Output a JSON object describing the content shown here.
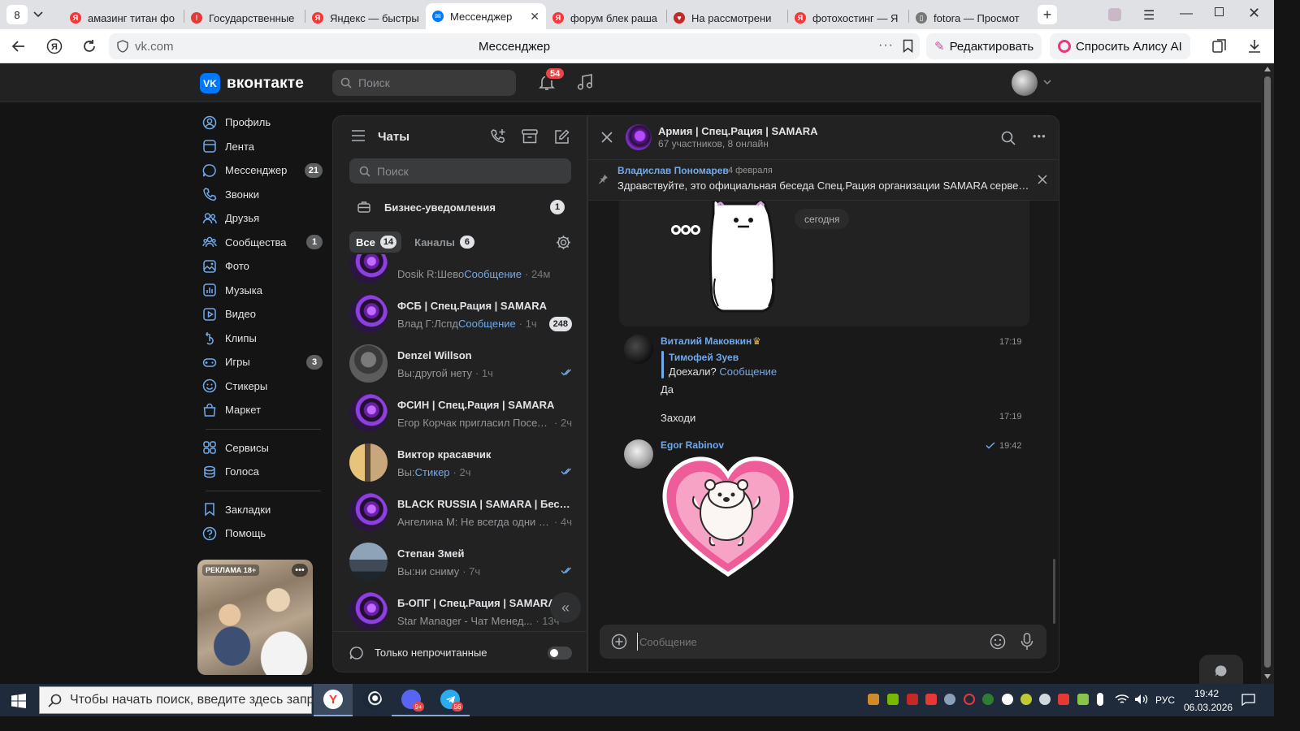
{
  "browser": {
    "tab_count": "8",
    "tabs": [
      {
        "title": "амазинг титан фо",
        "fav_color": "#f33",
        "fav_glyph": "Я",
        "active": false
      },
      {
        "title": "Государственные",
        "fav_color": "#e53935",
        "fav_glyph": "!",
        "active": false
      },
      {
        "title": "Яндекс — быстры",
        "fav_color": "#f33",
        "fav_glyph": "Я",
        "active": false
      },
      {
        "title": "Мессенджер",
        "fav_color": "#0077ff",
        "fav_glyph": "✉",
        "active": true
      },
      {
        "title": "форум блек раша",
        "fav_color": "#f33",
        "fav_glyph": "Я",
        "active": false
      },
      {
        "title": "На рассмотрени",
        "fav_color": "#c62828",
        "fav_glyph": "♥",
        "active": false
      },
      {
        "title": "фотохостинг — Я",
        "fav_color": "#f33",
        "fav_glyph": "Я",
        "active": false
      },
      {
        "title": "fotora — Просмот",
        "fav_color": "#777",
        "fav_glyph": "▯",
        "active": false
      }
    ],
    "url": "vk.com",
    "page_title": "Мессенджер",
    "edit_label": "Редактировать",
    "alice_label": "Спросить Алису AI"
  },
  "vk": {
    "logo_text": "вконтакте",
    "logo_mark": "VK",
    "search_placeholder": "Поиск",
    "notifications_count": "54",
    "nav": [
      {
        "label": "Профиль",
        "icon": "profile-icon",
        "count": ""
      },
      {
        "label": "Лента",
        "icon": "feed-icon",
        "count": ""
      },
      {
        "label": "Мессенджер",
        "icon": "messenger-icon",
        "count": "21"
      },
      {
        "label": "Звонки",
        "icon": "phone-icon",
        "count": ""
      },
      {
        "label": "Друзья",
        "icon": "friends-icon",
        "count": ""
      },
      {
        "label": "Сообщества",
        "icon": "communities-icon",
        "count": "1"
      },
      {
        "label": "Фото",
        "icon": "photo-icon",
        "count": ""
      },
      {
        "label": "Музыка",
        "icon": "music-icon",
        "count": ""
      },
      {
        "label": "Видео",
        "icon": "video-icon",
        "count": ""
      },
      {
        "label": "Клипы",
        "icon": "clips-icon",
        "count": ""
      },
      {
        "label": "Игры",
        "icon": "games-icon",
        "count": "3"
      },
      {
        "label": "Стикеры",
        "icon": "stickers-icon",
        "count": ""
      },
      {
        "label": "Маркет",
        "icon": "market-icon",
        "count": ""
      }
    ],
    "nav2": [
      {
        "label": "Сервисы",
        "icon": "services-icon"
      },
      {
        "label": "Голоса",
        "icon": "votes-icon"
      }
    ],
    "nav3": [
      {
        "label": "Закладки",
        "icon": "bookmark-icon"
      },
      {
        "label": "Помощь",
        "icon": "help-icon"
      }
    ],
    "ad_label": "РЕКЛАМА 18+"
  },
  "chats": {
    "title": "Чаты",
    "search_placeholder": "Поиск",
    "business_label": "Бизнес-уведомления",
    "business_count": "1",
    "tab_all": "Все",
    "tab_all_count": "14",
    "tab_channels": "Каналы",
    "tab_channels_count": "6",
    "list": [
      {
        "name": "",
        "sender": "Dosik R: ",
        "text": "Шево ",
        "link": "Сообщение",
        "time": " · 24м",
        "unread": "",
        "read": false,
        "av": "purple"
      },
      {
        "name": "ФСБ | Спец.Рация | SAMARA",
        "sender": "Влад Г: ",
        "text": "Лспд ",
        "link": "Сообщение",
        "time": " · 1ч",
        "unread": "248",
        "read": false,
        "av": "purple"
      },
      {
        "name": "Denzel Willson",
        "sender": "Вы: ",
        "text": "другой нету",
        "link": "",
        "time": " · 1ч",
        "unread": "",
        "read": true,
        "av": "grey"
      },
      {
        "name": "ФСИН | Спец.Рация | SAMARA",
        "sender": "",
        "text": "Егор Корчак пригласил Посел...",
        "link": "",
        "time": " · 2ч",
        "unread": "",
        "read": false,
        "av": "purple"
      },
      {
        "name": "Виктор красавчик",
        "sender": "Вы: ",
        "text": "",
        "link": "Стикер",
        "time": " · 2ч",
        "unread": "",
        "read": true,
        "av": "photo"
      },
      {
        "name": "BLACK RUSSIA | SAMARA | Беседа...",
        "sender": "",
        "text": "Ангелина М: Не всегда одни и ...",
        "link": "",
        "time": " · 4ч",
        "unread": "",
        "read": false,
        "av": "purple"
      },
      {
        "name": "Степан Змей",
        "sender": "Вы: ",
        "text": "ни сниму",
        "link": "",
        "time": " · 7ч",
        "unread": "",
        "read": true,
        "av": "street"
      },
      {
        "name": "Б-ОПГ | Спец.Рация | SAMARA",
        "sender": "",
        "text": "Star Manager - Чат Менед...",
        "link": "",
        "time": " · 13ч",
        "unread": "",
        "read": false,
        "av": "purple"
      }
    ],
    "unread_only_label": "Только непрочитанные"
  },
  "conversation": {
    "title": "Армия | Спец.Рация | SAMARA",
    "subtitle": "67 участников, 8 онлайн",
    "pinned_author": "Владислав Пономарев",
    "pinned_date": "4 февраля",
    "pinned_text": "Здравствуйте, это официальная беседа Спец.Рация организации SAMARA сервера...",
    "date_chip": "сегодня",
    "messages": [
      {
        "author": "Виталий Маковкин",
        "time": "17:19",
        "reply_author": "Тимофей Зуев",
        "reply_text": "Доехали? ",
        "reply_link": "Сообщение",
        "text": "Да"
      },
      {
        "author": "",
        "time": "17:19",
        "text": "Заходи"
      },
      {
        "author": "Egor Rabinov",
        "time": "19:42",
        "text": ""
      }
    ],
    "composer_placeholder": "Сообщение"
  },
  "taskbar": {
    "search_placeholder": "Чтобы начать поиск, введите здесь запрос",
    "lang": "РУС",
    "time": "19:42",
    "date": "06.03.2026",
    "discord_badge": "9+",
    "telegram_badge": "56"
  },
  "colors": {
    "accent": "#71aaeb",
    "vk_blue": "#0077ff",
    "badge_red": "#e64646",
    "bg": "#141414",
    "panel": "#222222"
  }
}
